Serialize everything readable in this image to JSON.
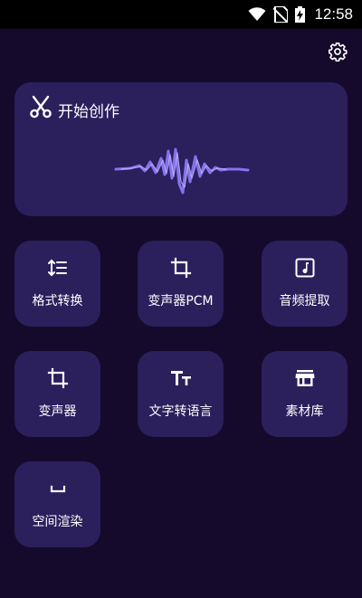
{
  "status_bar": {
    "time": "12:58"
  },
  "settings": {
    "icon": "gear-icon"
  },
  "hero": {
    "title": "开始创作",
    "icon": "scissors-icon"
  },
  "tiles": [
    {
      "label": "格式转换",
      "icon": "sort-lines-icon"
    },
    {
      "label": "变声器PCM",
      "icon": "crop-icon"
    },
    {
      "label": "音频提取",
      "icon": "music-note-icon"
    },
    {
      "label": "变声器",
      "icon": "crop-icon"
    },
    {
      "label": "文字转语言",
      "icon": "text-size-icon"
    },
    {
      "label": "素材库",
      "icon": "store-icon"
    },
    {
      "label": "空间渲染",
      "icon": "space-bar-icon"
    }
  ],
  "colors": {
    "background": "#150a2b",
    "card": "#2b1f5c",
    "wave": "#8f7bff"
  }
}
